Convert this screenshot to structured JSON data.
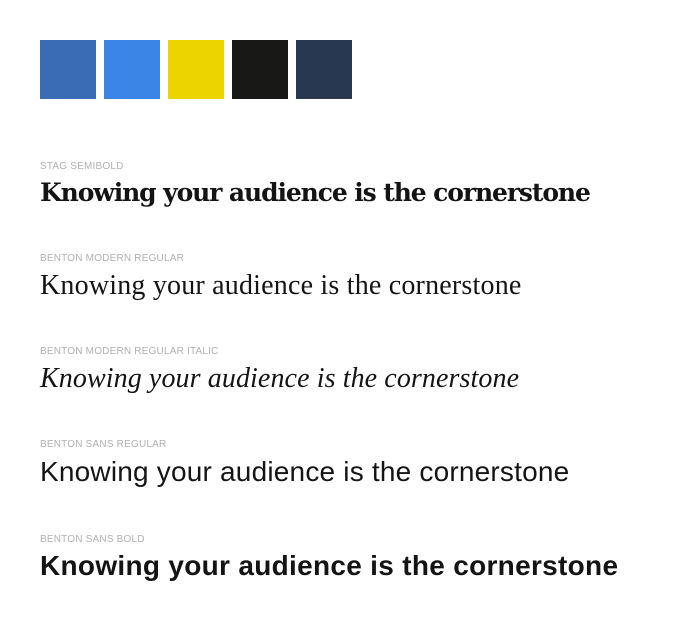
{
  "palette": {
    "swatches": [
      {
        "name": "blue-swatch",
        "color": "#3a6bb5"
      },
      {
        "name": "bright-blue-swatch",
        "color": "#3a85e6"
      },
      {
        "name": "yellow-swatch",
        "color": "#ecd400"
      },
      {
        "name": "black-swatch",
        "color": "#181816"
      },
      {
        "name": "navy-swatch",
        "color": "#283850"
      }
    ]
  },
  "specimens": [
    {
      "label": "STAG SEMIBOLD",
      "sample": "Knowing your audience is the cornerstone"
    },
    {
      "label": "BENTON MODERN REGULAR",
      "sample": "Knowing your audience is the cornerstone"
    },
    {
      "label": "BENTON MODERN REGULAR ITALIC",
      "sample": "Knowing your audience is the cornerstone"
    },
    {
      "label": "BENTON SANS REGULAR",
      "sample": "Knowing your audience is the cornerstone"
    },
    {
      "label": "BENTON SANS BOLD",
      "sample": "Knowing your audience is the cornerstone"
    }
  ]
}
